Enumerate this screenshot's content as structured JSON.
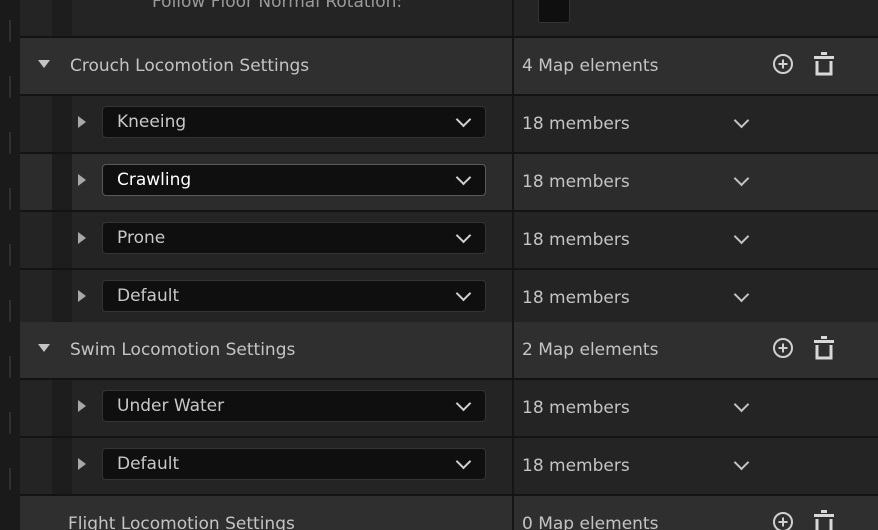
{
  "top_row": {
    "label": "Follow Floor Normal Rotation:"
  },
  "sections": [
    {
      "title": "Crouch Locomotion Settings",
      "count": "4 Map elements",
      "items": [
        {
          "name": "Kneeing",
          "members": "18 members"
        },
        {
          "name": "Crawling",
          "members": "18 members"
        },
        {
          "name": "Prone",
          "members": "18 members"
        },
        {
          "name": "Default",
          "members": "18 members"
        }
      ]
    },
    {
      "title": "Swim Locomotion Settings",
      "count": "2 Map elements",
      "items": [
        {
          "name": "Under Water",
          "members": "18 members"
        },
        {
          "name": "Default",
          "members": "18 members"
        }
      ]
    },
    {
      "title": "Flight Locomotion Settings",
      "count": "0 Map elements",
      "items": []
    }
  ],
  "icons": {
    "add": "plus-circle-icon",
    "delete": "trash-icon",
    "expand": "triangle-right-icon",
    "collapse": "triangle-down-icon",
    "dropdown": "chevron-down-icon"
  },
  "colors": {
    "background": "#151515",
    "category_row": "#2f2f2f",
    "member_row": "#242424",
    "combo_bg": "#0f0f0f",
    "text": "#c4c4c4"
  }
}
